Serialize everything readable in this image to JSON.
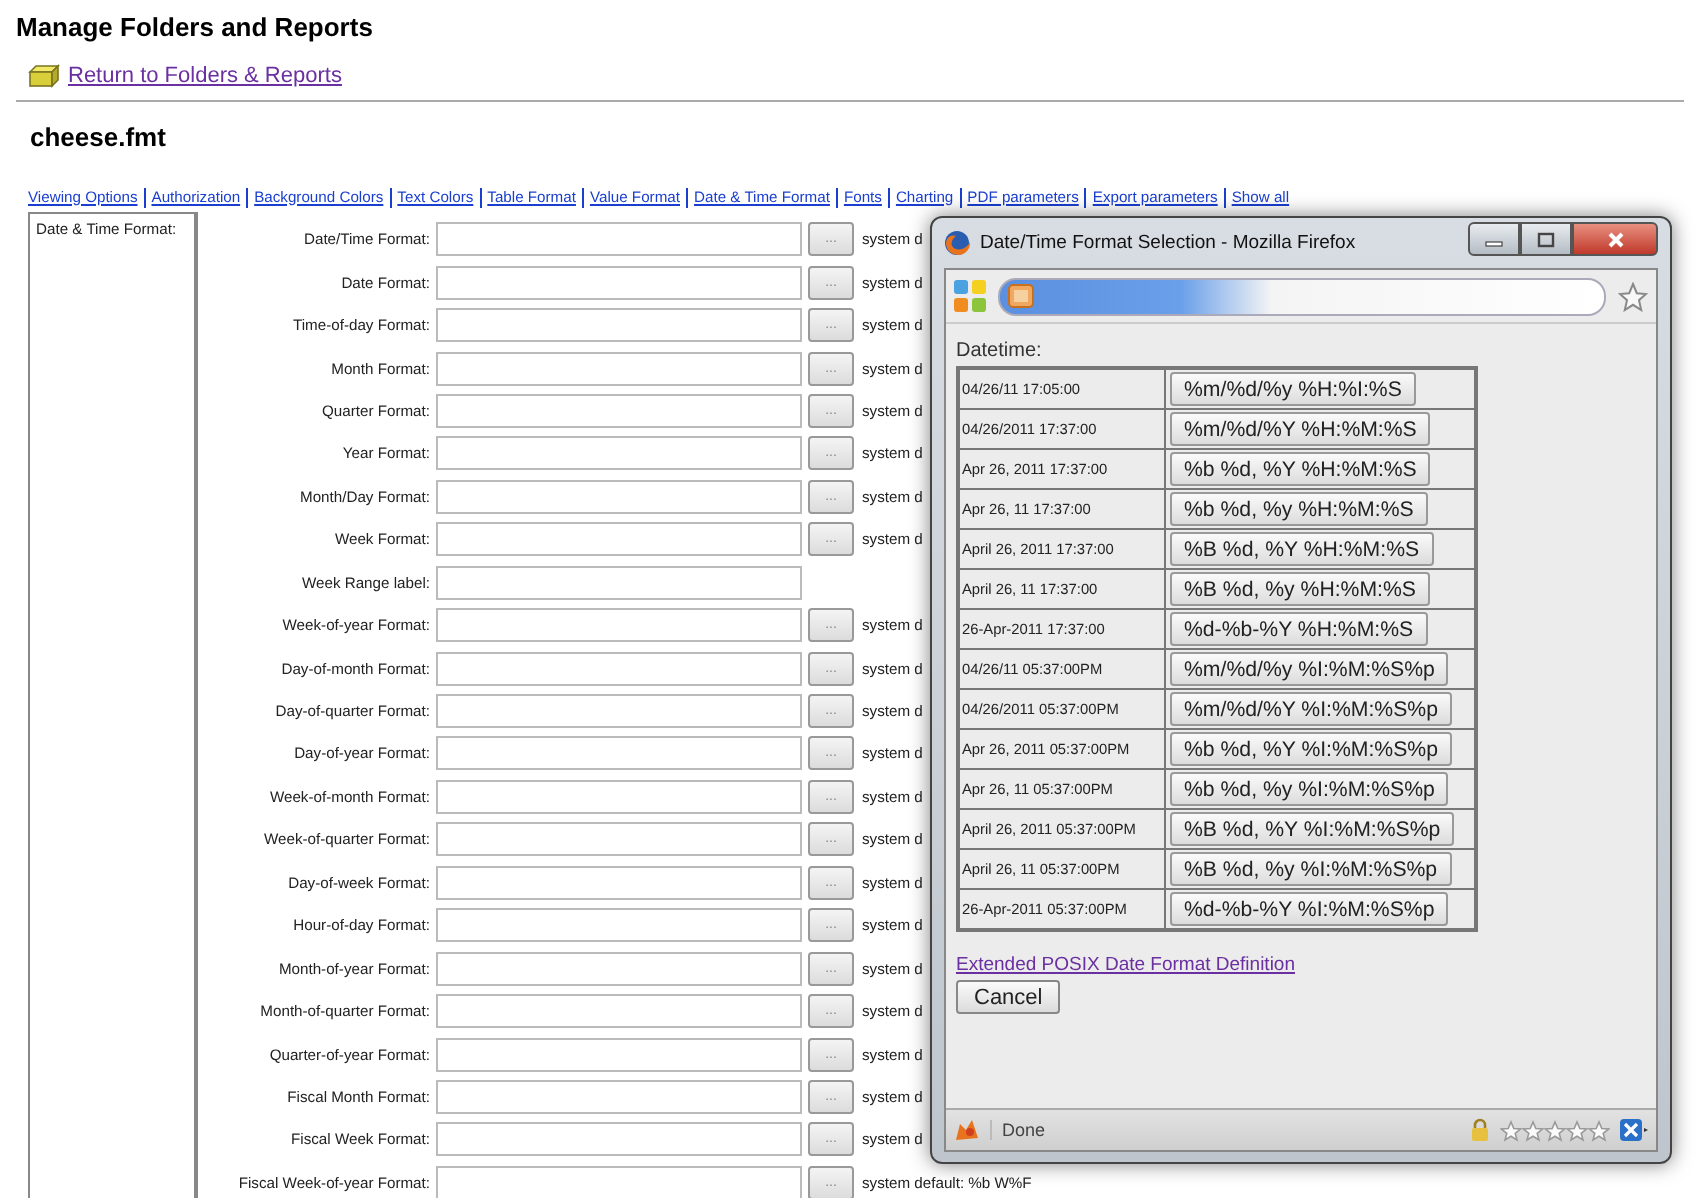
{
  "page": {
    "title": "Manage Folders and Reports",
    "back_link": "Return to Folders & Reports",
    "file_name": "cheese.fmt"
  },
  "tabs": [
    "Viewing Options",
    "Authorization",
    "Background Colors",
    "Text Colors",
    "Table Format",
    "Value Format",
    "Date & Time Format",
    "Fonts",
    "Charting",
    "PDF parameters",
    "Export parameters",
    "Show all"
  ],
  "section": {
    "label": "Date & Time Format:",
    "rows": [
      {
        "kind": "picker",
        "label": "Date/Time Format:",
        "button": "...",
        "default": "system d"
      },
      {
        "kind": "picker",
        "label": "Date Format:",
        "button": "...",
        "default": "system d"
      },
      {
        "kind": "picker",
        "label": "Time-of-day Format:",
        "button": "...",
        "default": "system d"
      },
      {
        "kind": "picker",
        "label": "Month Format:",
        "button": "...",
        "default": "system d"
      },
      {
        "kind": "picker",
        "label": "Quarter Format:",
        "button": "...",
        "default": "system d"
      },
      {
        "kind": "picker",
        "label": "Year Format:",
        "button": "...",
        "default": "system d"
      },
      {
        "kind": "picker",
        "label": "Month/Day Format:",
        "button": "...",
        "default": "system d"
      },
      {
        "kind": "picker",
        "label": "Week Format:",
        "button": "...",
        "default": "system d"
      },
      {
        "kind": "text",
        "label": "Week Range label:"
      },
      {
        "kind": "picker",
        "label": "Week-of-year Format:",
        "button": "...",
        "default": "system d"
      },
      {
        "kind": "picker",
        "label": "Day-of-month Format:",
        "button": "...",
        "default": "system d"
      },
      {
        "kind": "picker",
        "label": "Day-of-quarter Format:",
        "button": "...",
        "default": "system d"
      },
      {
        "kind": "picker",
        "label": "Day-of-year Format:",
        "button": "...",
        "default": "system d"
      },
      {
        "kind": "picker",
        "label": "Week-of-month Format:",
        "button": "...",
        "default": "system d"
      },
      {
        "kind": "picker",
        "label": "Week-of-quarter Format:",
        "button": "...",
        "default": "system d"
      },
      {
        "kind": "picker",
        "label": "Day-of-week Format:",
        "button": "...",
        "default": "system d"
      },
      {
        "kind": "picker",
        "label": "Hour-of-day Format:",
        "button": "...",
        "default": "system d"
      },
      {
        "kind": "picker",
        "label": "Month-of-year Format:",
        "button": "...",
        "default": "system d"
      },
      {
        "kind": "picker",
        "label": "Month-of-quarter Format:",
        "button": "...",
        "default": "system d"
      },
      {
        "kind": "picker",
        "label": "Quarter-of-year Format:",
        "button": "...",
        "default": "system d"
      },
      {
        "kind": "picker",
        "label": "Fiscal Month Format:",
        "button": "...",
        "default": "system d"
      },
      {
        "kind": "picker",
        "label": "Fiscal Week Format:",
        "button": "...",
        "default": "system d"
      },
      {
        "kind": "picker",
        "label": "Fiscal Week-of-year Format:",
        "button": "...",
        "default": "system default: %b W%F"
      }
    ]
  },
  "popup": {
    "title": "Date/Time Format Selection - Mozilla Firefox",
    "heading": "Datetime:",
    "formats": [
      {
        "example": "04/26/11 17:05:00",
        "format": "%m/%d/%y %H:%I:%S"
      },
      {
        "example": "04/26/2011 17:37:00",
        "format": "%m/%d/%Y %H:%M:%S"
      },
      {
        "example": "Apr 26, 2011 17:37:00",
        "format": "%b %d, %Y %H:%M:%S"
      },
      {
        "example": "Apr 26, 11 17:37:00",
        "format": "%b %d, %y %H:%M:%S"
      },
      {
        "example": "April 26, 2011 17:37:00",
        "format": "%B %d, %Y %H:%M:%S"
      },
      {
        "example": "April 26, 11 17:37:00",
        "format": "%B %d, %y %H:%M:%S"
      },
      {
        "example": "26-Apr-2011 17:37:00",
        "format": "%d-%b-%Y %H:%M:%S"
      },
      {
        "example": "04/26/11 05:37:00PM",
        "format": "%m/%d/%y %I:%M:%S%p"
      },
      {
        "example": "04/26/2011 05:37:00PM",
        "format": "%m/%d/%Y %I:%M:%S%p"
      },
      {
        "example": "Apr 26, 2011 05:37:00PM",
        "format": "%b %d, %Y %I:%M:%S%p"
      },
      {
        "example": "Apr 26, 11 05:37:00PM",
        "format": "%b %d, %y %I:%M:%S%p"
      },
      {
        "example": "April 26, 2011 05:37:00PM",
        "format": "%B %d, %Y %I:%M:%S%p"
      },
      {
        "example": "April 26, 11 05:37:00PM",
        "format": "%B %d, %y %I:%M:%S%p"
      },
      {
        "example": "26-Apr-2011 05:37:00PM",
        "format": "%d-%b-%Y %I:%M:%S%p"
      }
    ],
    "link": "Extended POSIX Date Format Definition",
    "cancel": "Cancel",
    "status": "Done"
  }
}
